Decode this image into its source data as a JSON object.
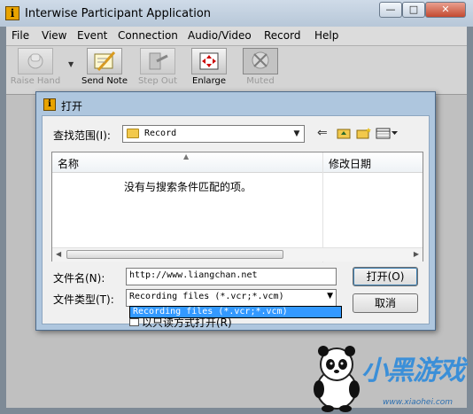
{
  "app": {
    "title": "Interwise Participant Application",
    "icon_letter": "i",
    "caption_buttons": {
      "minimize": "—",
      "maximize": "□",
      "close": "✕"
    }
  },
  "menu": [
    "File",
    "View",
    "Event",
    "Connection",
    "Audio/Video",
    "Record",
    "Help"
  ],
  "toolbar": [
    {
      "label": "Raise Hand",
      "icon": "raise-hand-icon",
      "enabled": false
    },
    {
      "label": "Send Note",
      "icon": "note-pencil-icon",
      "enabled": true
    },
    {
      "label": "Step Out",
      "icon": "step-out-icon",
      "enabled": false
    },
    {
      "label": "Enlarge",
      "icon": "enlarge-arrows-icon",
      "enabled": true
    },
    {
      "label": "Muted",
      "icon": "muted-icon",
      "enabled": false,
      "pressed": true
    }
  ],
  "dialog": {
    "title": "打开",
    "look_in_label": "查找范围(I):",
    "look_in_value": "Record",
    "columns": {
      "name": "名称",
      "date": "修改日期"
    },
    "empty_message": "没有与搜索条件匹配的项。",
    "filename_label": "文件名(N):",
    "filename_value": "http://www.liangchan.net",
    "filetype_label": "文件类型(T):",
    "filetype_value": "Recording files (*.vcr;*.vcm)",
    "filetype_dropdown_option": "Recording files (*.vcr;*.vcm)",
    "readonly_label": "以只读方式打开(R)",
    "open_button": "打开(O)",
    "cancel_button": "取消"
  },
  "watermark": {
    "text": "小黑游戏",
    "url": "www.xiaohei.com"
  },
  "colors": {
    "titlebar": "#b7c7d8",
    "dialog_frame": "#aec6de",
    "selection": "#3399ff"
  }
}
